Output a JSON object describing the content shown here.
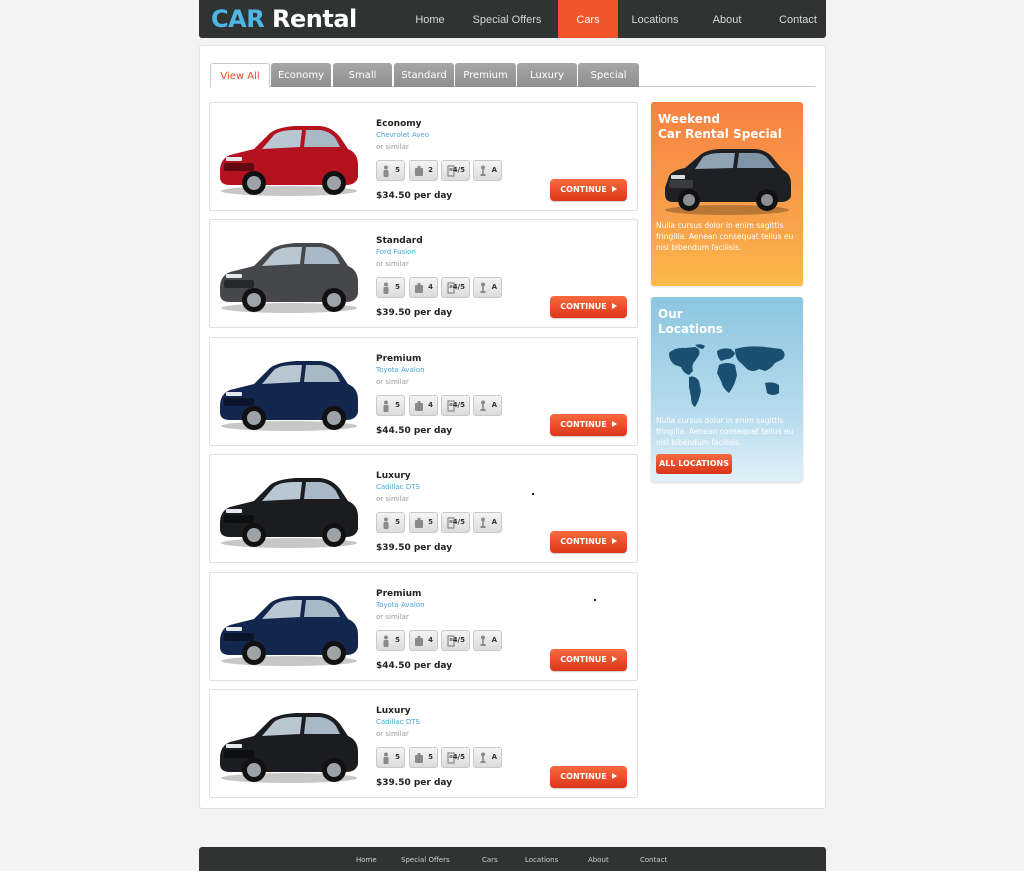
{
  "logo": {
    "part1": "CAR",
    "part2": "Rental"
  },
  "nav": [
    "Home",
    "Special Offers",
    "Cars",
    "Locations",
    "About",
    "Contact"
  ],
  "tabs": [
    "View All",
    "Economy",
    "Small",
    "Standard",
    "Premium",
    "Luxury",
    "Special"
  ],
  "cars": [
    {
      "class": "Economy",
      "model": "Chevrolet Aveo",
      "similar": "or similar",
      "specs": [
        "5",
        "2",
        "4/5",
        "A"
      ],
      "price": "$34.50 per day",
      "button": "CONTINUE",
      "color": "#b3121e"
    },
    {
      "class": "Standard",
      "model": "Ford Fusion",
      "similar": "or similar",
      "specs": [
        "5",
        "4",
        "4/5",
        "A"
      ],
      "price": "$39.50 per day",
      "button": "CONTINUE",
      "color": "#45474a"
    },
    {
      "class": "Premium",
      "model": "Toyota Avalon",
      "similar": "or similar",
      "specs": [
        "5",
        "4",
        "4/5",
        "A"
      ],
      "price": "$44.50 per day",
      "button": "CONTINUE",
      "color": "#13264d"
    },
    {
      "class": "Luxury",
      "model": "Cadillac DTS",
      "similar": "or similar",
      "specs": [
        "5",
        "5",
        "4/5",
        "A"
      ],
      "price": "$39.50 per day",
      "button": "CONTINUE",
      "color": "#1b1c1f"
    },
    {
      "class": "Premium",
      "model": "Toyota Avalon",
      "similar": "or similar",
      "specs": [
        "5",
        "4",
        "4/5",
        "A"
      ],
      "price": "$44.50 per day",
      "button": "CONTINUE",
      "color": "#13264d"
    },
    {
      "class": "Luxury",
      "model": "Cadillac DTS",
      "similar": "or similar",
      "specs": [
        "5",
        "5",
        "4/5",
        "A"
      ],
      "price": "$39.50 per day",
      "button": "CONTINUE",
      "color": "#1b1c1f"
    }
  ],
  "promo": {
    "title_line1": "Weekend",
    "title_line2": "Car Rental Special",
    "text": "Nulla cursus dolor in enim sagittis fringilla. Aenean consequat tellus eu nisl bibendum facilisis."
  },
  "locations": {
    "title_line1": "Our",
    "title_line2": "Locations",
    "text": "Nulla cursus dolor in enim sagittis fringilla. Aenean consequat tellus eu nisl bibendum facilisis.",
    "button": "ALL LOCATIONS"
  },
  "footer": [
    "Home",
    "Special Offers",
    "Cars",
    "Locations",
    "About",
    "Contact"
  ],
  "colors": {
    "accent": "#f1542b",
    "logo_blue": "#4fb6e6",
    "header_bg": "#2f3432"
  }
}
